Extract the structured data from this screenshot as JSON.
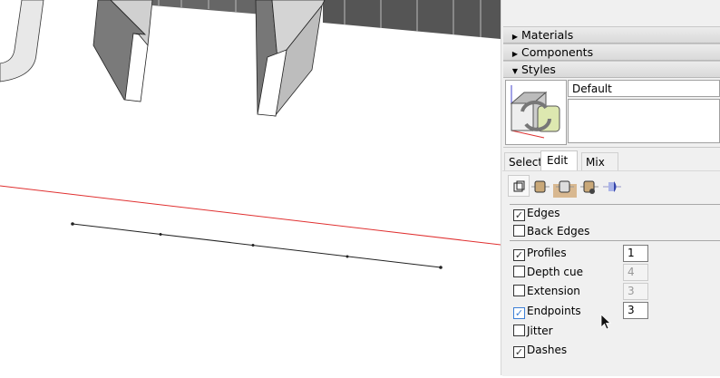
{
  "panel": {
    "trays": [
      {
        "label": "Materials",
        "expanded": false
      },
      {
        "label": "Components",
        "expanded": false
      },
      {
        "label": "Styles",
        "expanded": true
      }
    ],
    "style_name": "Default",
    "style_description": "",
    "tabs": [
      "Select",
      "Edit",
      "Mix"
    ],
    "active_tab": "Edit",
    "edit_icons": [
      "edge-settings-icon",
      "face-settings-icon",
      "background-settings-icon",
      "watermark-settings-icon",
      "modeling-settings-icon"
    ],
    "options": [
      {
        "label": "Edges",
        "checked": true
      },
      {
        "label": "Back Edges",
        "checked": false
      },
      {
        "label": "Profiles",
        "checked": true,
        "value": "1"
      },
      {
        "label": "Depth cue",
        "checked": false,
        "value": "4"
      },
      {
        "label": "Extension",
        "checked": false,
        "value": "3"
      },
      {
        "label": "Endpoints",
        "checked": true,
        "value": "3"
      },
      {
        "label": "Jitter",
        "checked": false
      },
      {
        "label": "Dashes",
        "checked": true
      }
    ]
  },
  "colors": {
    "axis_red": "#e03030",
    "active_icon_bg": "#d8b890"
  }
}
